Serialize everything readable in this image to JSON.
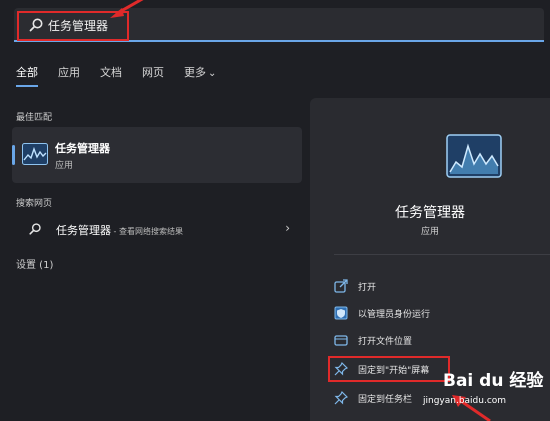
{
  "search": {
    "query": "任务管理器"
  },
  "tabs": [
    {
      "label": "全部",
      "active": true
    },
    {
      "label": "应用",
      "active": false
    },
    {
      "label": "文档",
      "active": false
    },
    {
      "label": "网页",
      "active": false
    },
    {
      "label": "更多",
      "active": false
    }
  ],
  "best_match": {
    "section_label": "最佳匹配",
    "name": "任务管理器",
    "type": "应用"
  },
  "web_search": {
    "section_label": "搜索网页",
    "query": "任务管理器",
    "suffix": " - 查看网络搜索结果"
  },
  "settings": {
    "section_label": "设置 (1)"
  },
  "panel": {
    "title": "任务管理器",
    "subtitle": "应用",
    "actions": [
      {
        "label": "打开",
        "icon": "open-icon"
      },
      {
        "label": "以管理员身份运行",
        "icon": "shield-icon"
      },
      {
        "label": "打开文件位置",
        "icon": "folder-icon"
      },
      {
        "label": "固定到\"开始\"屏幕",
        "icon": "pin-icon"
      },
      {
        "label": "固定到任务栏",
        "icon": "pin-icon"
      }
    ]
  },
  "watermark": {
    "logo": "Bai du 经验",
    "url": "jingyan.baidu.com"
  },
  "colors": {
    "accent": "#6aa6e8",
    "highlight": "#e02a2a",
    "background": "#1e1f24",
    "panel": "#2a2b30"
  }
}
